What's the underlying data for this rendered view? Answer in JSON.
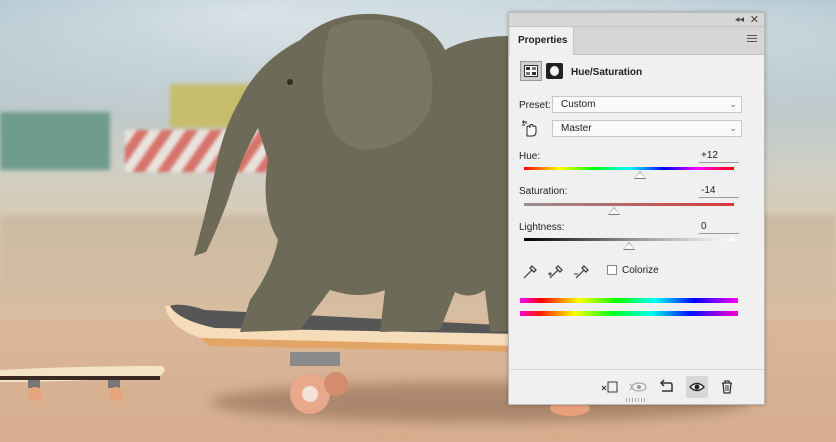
{
  "panel": {
    "tab_label": "Properties",
    "adjustment_title": "Hue/Saturation",
    "preset": {
      "label": "Preset:",
      "value": "Custom"
    },
    "channel": {
      "value": "Master"
    },
    "hue": {
      "label": "Hue:",
      "value": "+12",
      "slider_fraction": 0.55
    },
    "saturation": {
      "label": "Saturation:",
      "value": "-14",
      "slider_fraction": 0.43
    },
    "lightness": {
      "label": "Lightness:",
      "value": "0",
      "slider_fraction": 0.5
    },
    "colorize": {
      "label": "Colorize",
      "checked": false
    },
    "icons": {
      "collapse": "double-chevron-left-icon",
      "close": "close-icon",
      "menu": "hamburger-menu-icon",
      "adjustment_layer": "adjustment-layer-icon",
      "mask": "layer-mask-icon",
      "targeted_adjust": "targeted-adjustment-hand-icon",
      "eyedroppers": [
        "eyedropper-icon",
        "eyedropper-plus-icon",
        "eyedropper-minus-icon"
      ],
      "footer": [
        "clip-to-layer-icon",
        "view-previous-state-icon",
        "reset-icon",
        "visibility-eye-icon",
        "delete-icon"
      ]
    }
  }
}
